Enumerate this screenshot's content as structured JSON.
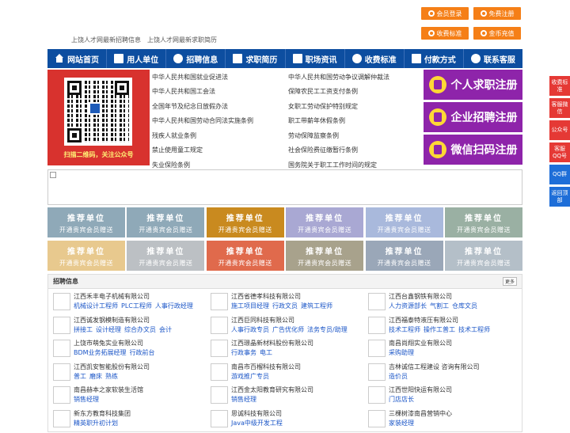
{
  "top_buttons": [
    "会员登录",
    "免费注册",
    "收费标准",
    "金币充值"
  ],
  "latest_links": [
    "上饶人才网最新招聘信息",
    "上饶人才网最新求职简历"
  ],
  "nav": [
    {
      "label": "网站首页",
      "icon": "home-icon"
    },
    {
      "label": "用人单位",
      "icon": "building-icon"
    },
    {
      "label": "招聘信息",
      "icon": "megaphone-icon"
    },
    {
      "label": "求职简历",
      "icon": "resume-icon"
    },
    {
      "label": "职场资讯",
      "icon": "news-icon"
    },
    {
      "label": "收费标准",
      "icon": "coin-icon"
    },
    {
      "label": "付款方式",
      "icon": "wallet-icon"
    },
    {
      "label": "联系客服",
      "icon": "phone-icon"
    }
  ],
  "qr": {
    "caption": "扫描二维码，关注公众号"
  },
  "laws": [
    "中华人民共和国就业促进法",
    "中华人民共和国劳动争议调解仲裁法",
    "中华人民共和国工会法",
    "保障农民工工资支付条例",
    "全国年节及纪念日放假办法",
    "女职工劳动保护特别规定",
    "中华人民共和国劳动合同法实施条例",
    "职工带薪年休假条例",
    "残疾人就业条例",
    "劳动保障监察条例",
    "禁止使用童工规定",
    "社会保险费征缴暂行条例",
    "失业保险条例",
    "国务院关于职工工作时间的规定"
  ],
  "register_buttons": [
    "个人求职注册",
    "企业招聘注册",
    "微信扫码注册"
  ],
  "side_bar": [
    "收费标准",
    "客服微信",
    "公众号",
    "客服QQ号",
    "QQ群",
    "返回顶部"
  ],
  "promo": {
    "title": "推荐单位",
    "subtitle": "开通贵宾会员赠送",
    "colors": [
      "#8fa9b8",
      "#8fa9b8",
      "#c98a1f",
      "#a9a8d3",
      "#a9b9dc",
      "#9ab0a3",
      "#e8c98e",
      "#bcc0c4",
      "#e06a4c",
      "#a8a28c",
      "#9aa7b8",
      "#b4bfc8"
    ]
  },
  "jobs": {
    "title": "招聘信息",
    "more": "更多",
    "items": [
      {
        "company": "江西禾丰电子机械有限公司",
        "positions": [
          "机械设计工程师",
          "PLC工程师",
          "人事行政经理"
        ]
      },
      {
        "company": "江西省德孝科技有限公司",
        "positions": [
          "施工项目经理",
          "行政文员",
          "建筑工程师"
        ]
      },
      {
        "company": "江西台鑫钢铁有限公司",
        "positions": [
          "人力资源部长",
          "气割工",
          "仓库文员"
        ]
      },
      {
        "company": "江西诚发钢模制造有限公司",
        "positions": [
          "拼接工",
          "设计经理",
          "综合办文员",
          "会计"
        ]
      },
      {
        "company": "江西巨同科技有限公司",
        "positions": [
          "人事行政专员",
          "广告优化师",
          "法务专员/助理"
        ]
      },
      {
        "company": "江西福泰特液压有限公司",
        "positions": [
          "技术工程师",
          "操作工普工",
          "技术工程师"
        ]
      },
      {
        "company": "上饶市萌兔实业有限公司",
        "positions": [
          "BDM业务拓展经理",
          "行政前台"
        ]
      },
      {
        "company": "江西璟晶新材料股份有限公司",
        "positions": [
          "行政事务",
          "电工"
        ]
      },
      {
        "company": "南昌尚翔实业有限公司",
        "positions": [
          "采购助理"
        ]
      },
      {
        "company": "江西凯安智能股份有限公司",
        "positions": [
          "普工",
          "磨床",
          "熟练"
        ]
      },
      {
        "company": "南昌市百榴科技有限公司",
        "positions": [
          "游戏推广专员"
        ]
      },
      {
        "company": "吉林诚信工程建设 咨询有限公司",
        "positions": [
          "造价员"
        ]
      },
      {
        "company": "南昌赫本之家软装生活馆",
        "positions": [
          "销售经理"
        ]
      },
      {
        "company": "江西金太阳教育研究有限公司",
        "positions": [
          "销售经理"
        ]
      },
      {
        "company": "江西世阳快运有限公司",
        "positions": [
          "门店店长"
        ]
      },
      {
        "company": "新东方教育科技集团",
        "positions": [
          "精英职升初计划"
        ]
      },
      {
        "company": "思诚科技有限公司",
        "positions": [
          "Java中级开发工程"
        ]
      },
      {
        "company": "三棵树漆南昌营销中心",
        "positions": [
          "家装经理"
        ]
      }
    ]
  }
}
